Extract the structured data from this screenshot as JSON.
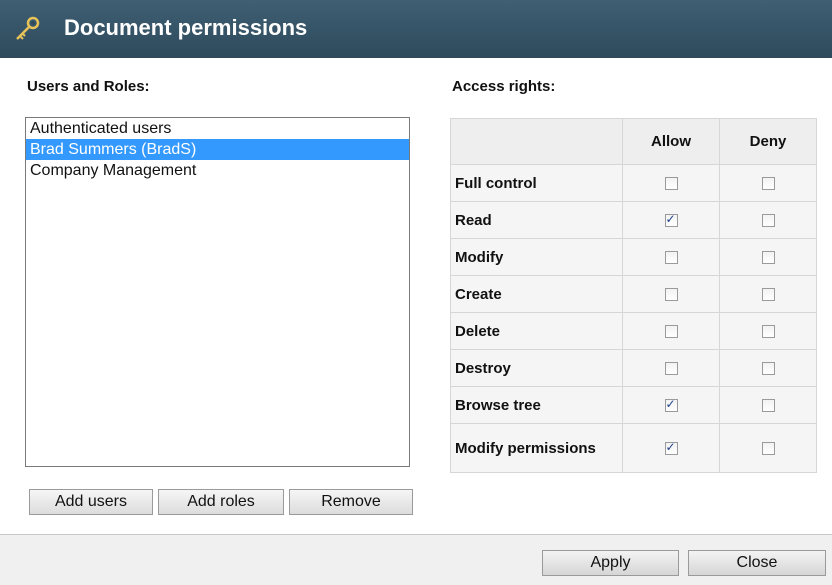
{
  "window": {
    "title": "Document permissions",
    "icon": "key-icon"
  },
  "users_section": {
    "label": "Users and Roles:",
    "items": [
      {
        "label": "Authenticated users",
        "selected": false
      },
      {
        "label": "Brad Summers (BradS)",
        "selected": true
      },
      {
        "label": "Company Management",
        "selected": false
      }
    ],
    "buttons": {
      "add_users": "Add users",
      "add_roles": "Add roles",
      "remove": "Remove"
    }
  },
  "access_section": {
    "label": "Access rights:",
    "columns": [
      "",
      "Allow",
      "Deny"
    ],
    "rows": [
      {
        "name": "Full control",
        "allow": false,
        "deny": false
      },
      {
        "name": "Read",
        "allow": true,
        "deny": false
      },
      {
        "name": "Modify",
        "allow": false,
        "deny": false
      },
      {
        "name": "Create",
        "allow": false,
        "deny": false
      },
      {
        "name": "Delete",
        "allow": false,
        "deny": false
      },
      {
        "name": "Destroy",
        "allow": false,
        "deny": false
      },
      {
        "name": "Browse tree",
        "allow": true,
        "deny": false
      },
      {
        "name": "Modify permissions",
        "allow": true,
        "deny": false
      }
    ]
  },
  "footer": {
    "apply": "Apply",
    "close": "Close"
  },
  "colors": {
    "title_bar": "#2e4a5c",
    "selection": "#3399ff",
    "table_header": "#eeeeee"
  }
}
